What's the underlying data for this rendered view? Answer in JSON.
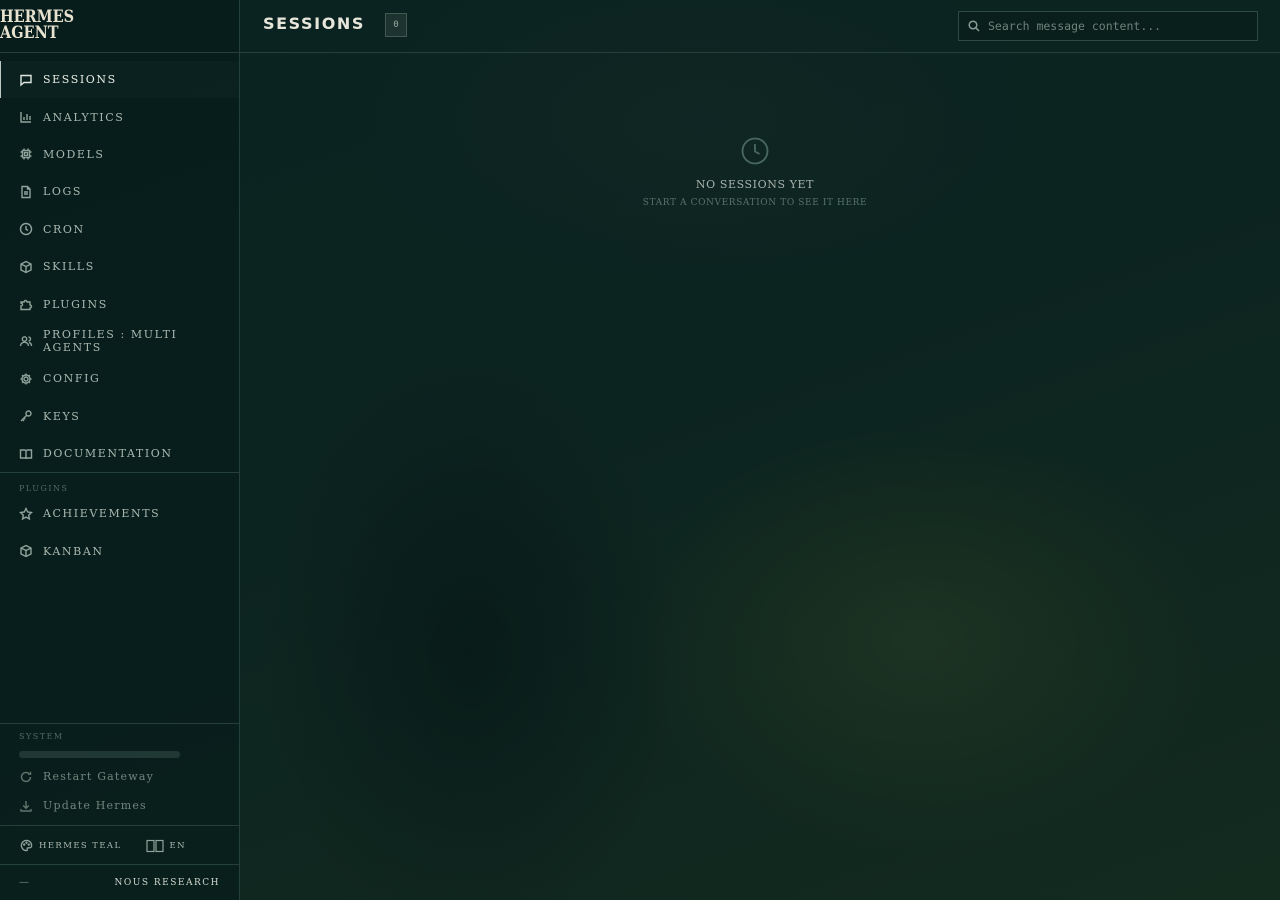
{
  "brand": {
    "line1": "HERMES",
    "line2": "AGENT"
  },
  "nav": [
    {
      "label": "SESSIONS",
      "icon": "chat-icon",
      "active": true
    },
    {
      "label": "ANALYTICS",
      "icon": "bar-chart-icon"
    },
    {
      "label": "MODELS",
      "icon": "chip-icon"
    },
    {
      "label": "LOGS",
      "icon": "document-icon"
    },
    {
      "label": "CRON",
      "icon": "clock-icon"
    },
    {
      "label": "SKILLS",
      "icon": "box-icon"
    },
    {
      "label": "PLUGINS",
      "icon": "puzzle-icon"
    },
    {
      "label": "PROFILES : MULTI AGENTS",
      "icon": "users-icon"
    },
    {
      "label": "CONFIG",
      "icon": "gear-icon"
    },
    {
      "label": "KEYS",
      "icon": "key-icon"
    },
    {
      "label": "DOCUMENTATION",
      "icon": "book-icon"
    }
  ],
  "plugins_section": {
    "heading": "PLUGINS",
    "items": [
      {
        "label": "ACHIEVEMENTS",
        "icon": "star-icon"
      },
      {
        "label": "KANBAN",
        "icon": "box-icon"
      }
    ]
  },
  "system": {
    "heading": "SYSTEM",
    "restart_label": "Restart Gateway",
    "update_label": "Update Hermes"
  },
  "footer": {
    "theme_label": "HERMES TEAL",
    "lang_label": "EN",
    "dash": "—",
    "credit": "NOUS RESEARCH"
  },
  "header": {
    "title": "SESSIONS",
    "count": "0",
    "search_placeholder": "Search message content..."
  },
  "empty_state": {
    "title": "NO SESSIONS YET",
    "subtitle": "START A CONVERSATION TO SEE IT HERE"
  },
  "colors": {
    "accent": "#dfe6de",
    "background": "#0b1f1d",
    "border": "#23403a"
  }
}
